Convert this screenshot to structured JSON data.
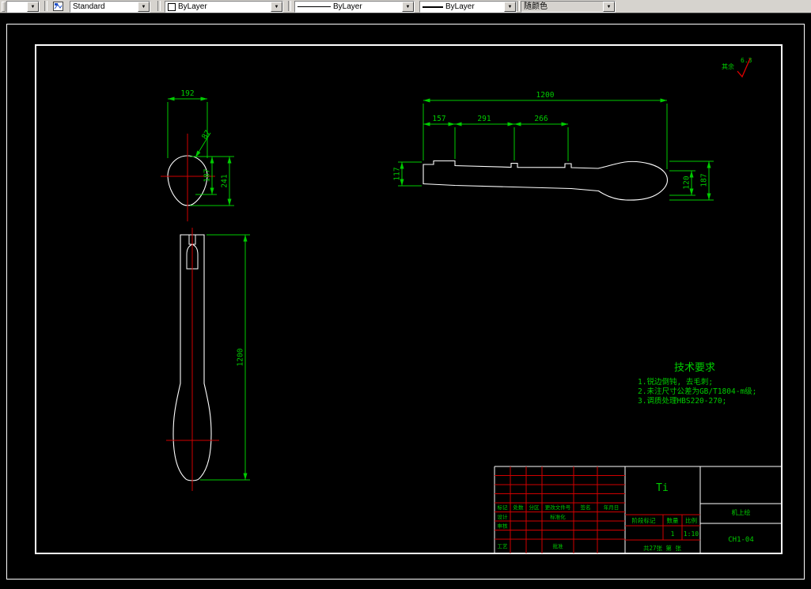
{
  "toolbar": {
    "layer_control": "",
    "text_style": "Standard",
    "color_control": "ByLayer",
    "linetype_control": "ByLayer",
    "lineweight_control": "ByLayer",
    "plot_style_control": "随颜色"
  },
  "icons": {
    "chevron_down": "▼"
  },
  "surface_finish": {
    "scope": "其余",
    "roughness": "6.3"
  },
  "tech_requirements": {
    "title": "技术要求",
    "lines": [
      "1.锐边倒钝, 去毛刺;",
      "2.未注尺寸公差为GB/T1804-m级;",
      "3.调质处理HBS220-270;"
    ]
  },
  "dims": {
    "section": {
      "width": "192",
      "slot": "87",
      "inner_height": "187",
      "outer_height": "241"
    },
    "side": {
      "overall": "1200",
      "seg1": "157",
      "seg2": "291",
      "seg3": "266",
      "tip_height": "117",
      "blade_neck": "120",
      "blade_height": "187"
    },
    "front": {
      "overall": "1200"
    }
  },
  "title_block": {
    "part_name": "Ti",
    "company": "机上绘",
    "drawing_number": "CH1-04",
    "stage_label": "阶段标记",
    "quantity_label": "数量",
    "scale_label": "比例",
    "quantity": "1",
    "scale": "1:10",
    "sheet_note": "共27张 第 张",
    "rev_headers": [
      "标记",
      "处数",
      "分区",
      "更改文件号",
      "签名",
      "年月日"
    ],
    "roles": {
      "design": "设计",
      "standardize": "标准化",
      "check": "审核",
      "process": "工艺",
      "approve": "批准"
    }
  },
  "colors": {
    "dimension": "#00cc00",
    "outline": "#ffffff",
    "centerline": "#d00000",
    "canvas": "#000000",
    "toolbar": "#d6d3ce"
  }
}
